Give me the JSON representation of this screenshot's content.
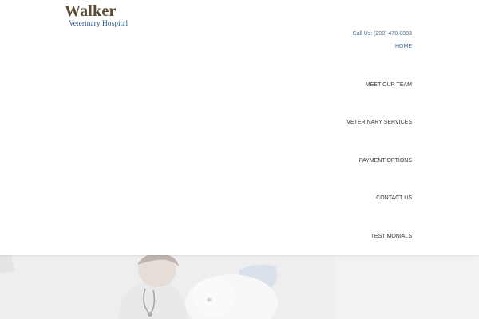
{
  "brand": {
    "name": "Walker",
    "subtitle": "Veterinary Hospital",
    "name_color": "#5b4a2e",
    "subtitle_color": "#2f5a84"
  },
  "contact": {
    "phone_label": "Call Us: (209) 478-8883"
  },
  "nav": {
    "items": [
      {
        "label": "HOME",
        "active": true
      },
      {
        "label": "MEET OUR TEAM",
        "active": false
      },
      {
        "label": "VETERINARY SERVICES",
        "active": false
      },
      {
        "label": "PAYMENT OPTIONS",
        "active": false
      },
      {
        "label": "CONTACT US",
        "active": false
      },
      {
        "label": "TESTIMONIALS",
        "active": false
      }
    ],
    "active_color": "#3c6a94"
  },
  "hero": {
    "image": "veterinarian-with-white-dog-photo"
  }
}
